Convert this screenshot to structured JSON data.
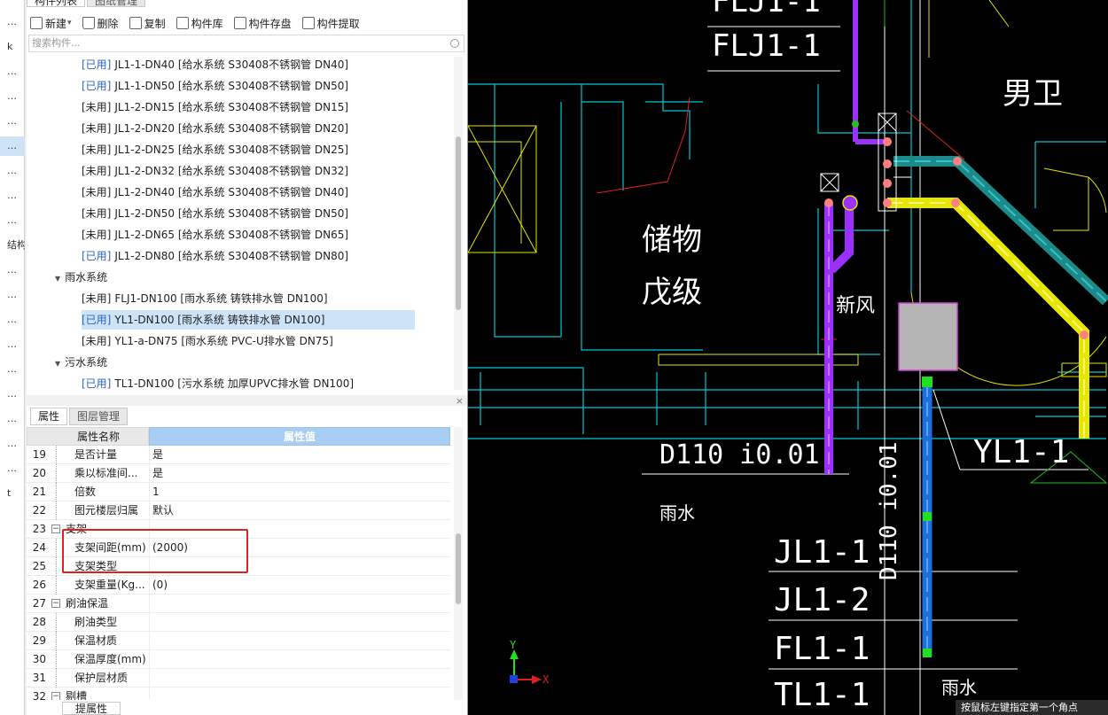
{
  "left_panel": {
    "tabs": [
      "构件列表",
      "图纸管理"
    ],
    "toolbar": {
      "new": "新建",
      "delete": "删除",
      "copy": "复制",
      "library": "构件库",
      "save": "构件存盘",
      "extract": "构件提取"
    },
    "search_placeholder": "搜索构件...",
    "tree": [
      {
        "status": "[已用]",
        "name": "JL1-1-DN40 [给水系统 S30408不锈钢管 DN40]",
        "used": true
      },
      {
        "status": "[已用]",
        "name": "JL1-1-DN50 [给水系统 S30408不锈钢管 DN50]",
        "used": true
      },
      {
        "status": "[未用]",
        "name": "JL1-2-DN15 [给水系统 S30408不锈钢管 DN15]",
        "used": false
      },
      {
        "status": "[未用]",
        "name": "JL1-2-DN20 [给水系统 S30408不锈钢管 DN20]",
        "used": false
      },
      {
        "status": "[未用]",
        "name": "JL1-2-DN25 [给水系统 S30408不锈钢管 DN25]",
        "used": false
      },
      {
        "status": "[未用]",
        "name": "JL1-2-DN32 [给水系统 S30408不锈钢管 DN32]",
        "used": false
      },
      {
        "status": "[未用]",
        "name": "JL1-2-DN40 [给水系统 S30408不锈钢管 DN40]",
        "used": false
      },
      {
        "status": "[未用]",
        "name": "JL1-2-DN50 [给水系统 S30408不锈钢管 DN50]",
        "used": false
      },
      {
        "status": "[未用]",
        "name": "JL1-2-DN65 [给水系统 S30408不锈钢管 DN65]",
        "used": false
      },
      {
        "status": "[已用]",
        "name": "JL1-2-DN80 [给水系统 S30408不锈钢管 DN80]",
        "used": true
      }
    ],
    "group_rain": "雨水系统",
    "rain_items": [
      {
        "status": "[未用]",
        "name": "FLJ1-DN100 [雨水系统 铸铁排水管 DN100]",
        "used": false
      },
      {
        "status": "[已用]",
        "name": "YL1-DN100 [雨水系统 铸铁排水管 DN100]",
        "used": true,
        "selected": true
      },
      {
        "status": "[未用]",
        "name": "YL1-a-DN75 [雨水系统 PVC-U排水管 DN75]",
        "used": false
      }
    ],
    "group_waste": "污水系统",
    "waste_items": [
      {
        "status": "[已用]",
        "name": "TL1-DN100 [污水系统 加厚UPVC排水管 DN100]",
        "used": true
      }
    ],
    "prop_tabs": [
      "属性",
      "图层管理"
    ],
    "prop_header": {
      "name": "属性名称",
      "value": "属性值"
    },
    "props": [
      {
        "n": "19",
        "name": "是否计量",
        "value": "是"
      },
      {
        "n": "20",
        "name": "乘以标准间...",
        "value": "是"
      },
      {
        "n": "21",
        "name": "倍数",
        "value": "1"
      },
      {
        "n": "22",
        "name": "图元楼层归属",
        "value": "默认"
      },
      {
        "n": "23",
        "name": "支架",
        "value": "",
        "group": true
      },
      {
        "n": "24",
        "name": "支架间距(mm)",
        "value": "(2000)"
      },
      {
        "n": "25",
        "name": "支架类型",
        "value": ""
      },
      {
        "n": "26",
        "name": "支架重量(Kg...",
        "value": "(0)"
      },
      {
        "n": "27",
        "name": "刷油保温",
        "value": "",
        "group": true
      },
      {
        "n": "28",
        "name": "刷油类型",
        "value": ""
      },
      {
        "n": "29",
        "name": "保温材质",
        "value": ""
      },
      {
        "n": "30",
        "name": "保温厚度(mm)",
        "value": ""
      },
      {
        "n": "31",
        "name": "保护层材质",
        "value": ""
      },
      {
        "n": "32",
        "name": "剔槽",
        "value": "",
        "group": true
      }
    ],
    "bottom_tab": "提属性"
  },
  "left_strip": [
    "…",
    "k",
    "…",
    "…",
    "…",
    "…",
    "…",
    "…",
    "…",
    "结构",
    "…",
    "…",
    "…",
    "…",
    "…",
    "…",
    "…",
    "…",
    "…",
    "t"
  ],
  "cad": {
    "labels": {
      "flj_top": "FLJ1-1",
      "men_wc": "男卫",
      "storage": "储物",
      "storage2": "戊级",
      "fresh_air": "新风",
      "d110_left": "D110 i0.01",
      "rain_left": "雨水",
      "yl1": "YL1-1",
      "jl1_1": "JL1-1",
      "jl1_2": "JL1-2",
      "fl1_1": "FL1-1",
      "tl1_1": "TL1-1",
      "d110_vert": "D110 i0.01",
      "rain_bottom": "雨水",
      "axis_y": "Y",
      "axis_x": "X"
    },
    "status_text": "按鼠标左键指定第一个角点",
    "colors": {
      "pipe_purple": "#9b30ff",
      "pipe_blue": "#1e6fd9",
      "pipe_yellow": "#e6e600",
      "pipe_teal": "#1a8a8a",
      "wall_cyan": "#00c8d8",
      "selected_red": "#e02020"
    }
  }
}
